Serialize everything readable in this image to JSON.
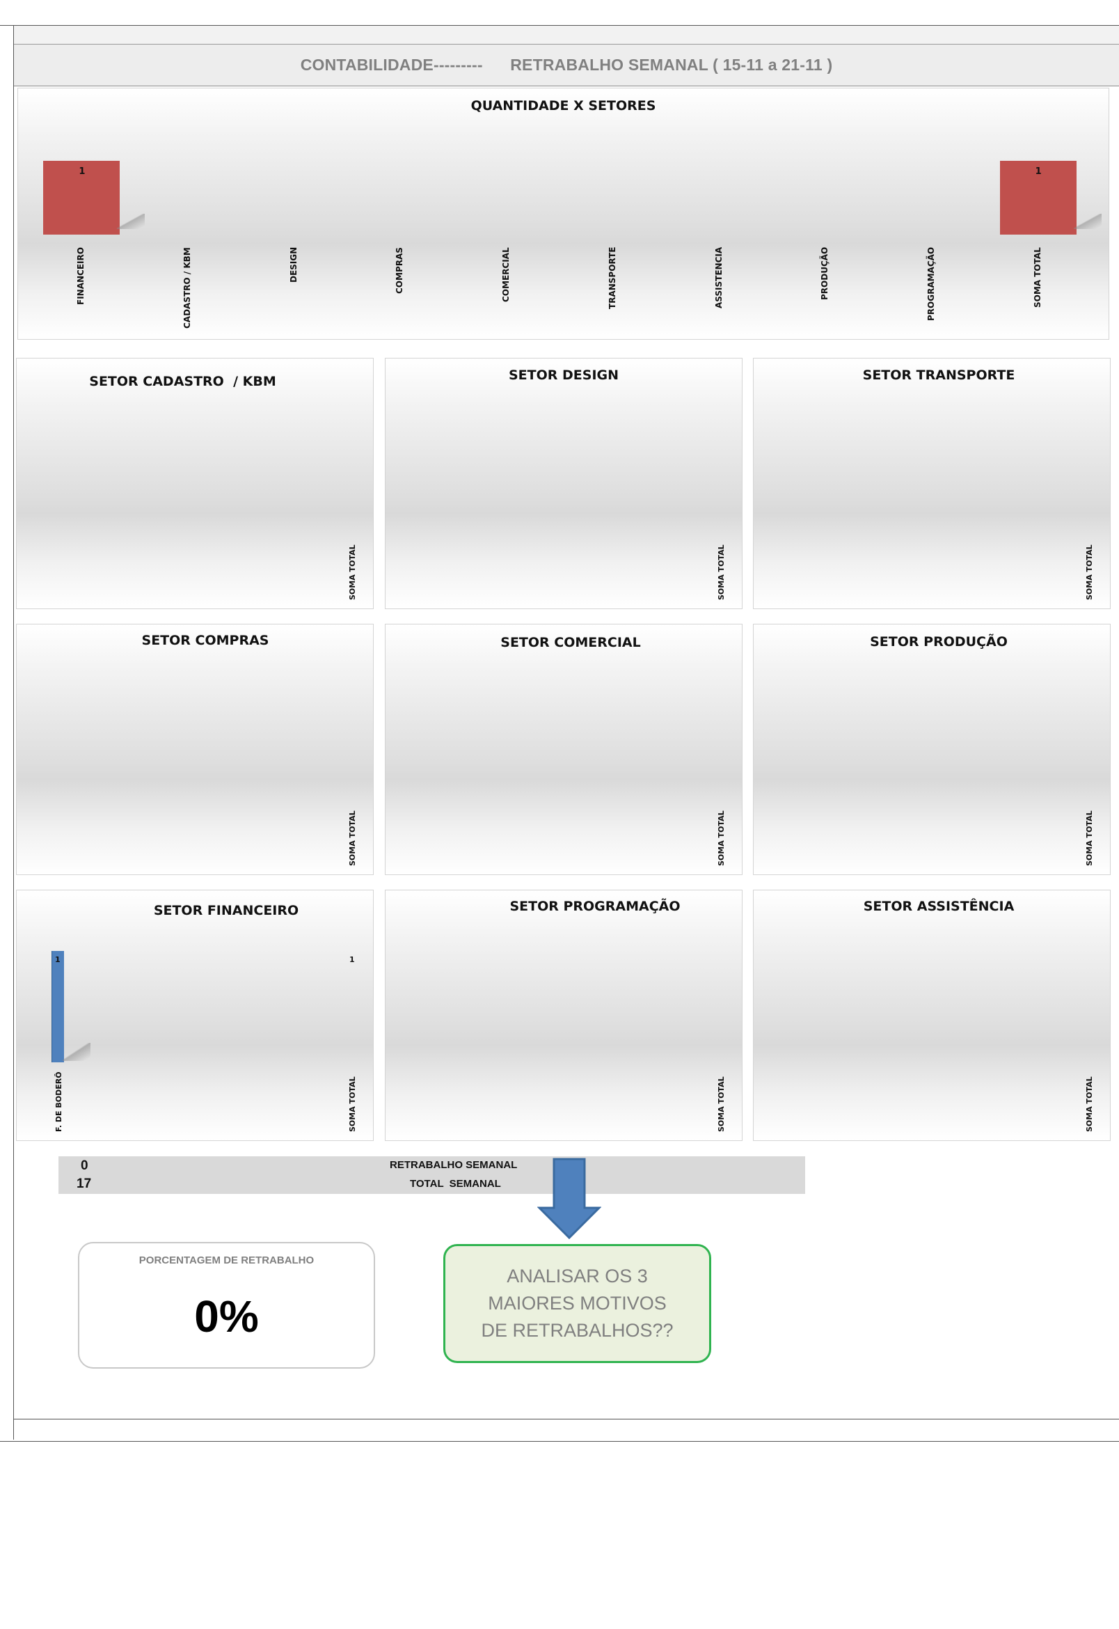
{
  "header": {
    "title_left": "CONTABILIDADE---------",
    "title_right": "RETRABALHO SEMANAL ( 15-11 a 21-11 )"
  },
  "colors": {
    "bar_red": "#c0504d",
    "bar_blue": "#4f81bd",
    "accent_green": "#2fb34f",
    "arrow_blue": "#4f81bd"
  },
  "chart_data": [
    {
      "type": "bar",
      "title": "QUANTIDADE X SETORES",
      "categories": [
        "FINANCEIRO",
        "CADASTRO / KBM",
        "DESIGN",
        "COMPRAS",
        "COMERCIAL",
        "TRANSPORTE",
        "ASSISTENCIA",
        "PRODUÇÃO",
        "PROGRAMAÇÃO",
        "SOMA TOTAL"
      ],
      "values": [
        1,
        null,
        null,
        null,
        null,
        null,
        null,
        null,
        null,
        1
      ],
      "data_labels": [
        "1",
        "",
        "",
        "",
        "",
        "",
        "",
        "",
        "",
        "1"
      ],
      "color": "#c0504d",
      "grid": false
    },
    {
      "type": "bar",
      "title": "SETOR CADASTRO  / KBM",
      "categories": [
        "SOMA TOTAL"
      ],
      "values": [
        null
      ]
    },
    {
      "type": "bar",
      "title": "SETOR DESIGN",
      "categories": [
        "SOMA TOTAL"
      ],
      "values": [
        null
      ]
    },
    {
      "type": "bar",
      "title": "SETOR TRANSPORTE",
      "categories": [
        "SOMA TOTAL"
      ],
      "values": [
        null
      ]
    },
    {
      "type": "bar",
      "title": "SETOR COMPRAS",
      "categories": [
        "SOMA TOTAL"
      ],
      "values": [
        null
      ]
    },
    {
      "type": "bar",
      "title": "SETOR COMERCIAL",
      "categories": [
        "SOMA TOTAL"
      ],
      "values": [
        null
      ]
    },
    {
      "type": "bar",
      "title": "SETOR PRODUÇÃO",
      "categories": [
        "SOMA TOTAL"
      ],
      "values": [
        null
      ]
    },
    {
      "type": "bar",
      "title": "SETOR FINANCEIRO",
      "categories": [
        "F. DE BODERÔ",
        "SOMA TOTAL"
      ],
      "values": [
        1,
        1
      ],
      "data_labels": [
        "1",
        "1"
      ],
      "color": "#4f81bd"
    },
    {
      "type": "bar",
      "title": "SETOR PROGRAMAÇÃO",
      "categories": [
        "SOMA TOTAL"
      ],
      "values": [
        null
      ]
    },
    {
      "type": "bar",
      "title": "SETOR ASSISTÊNCIA",
      "categories": [
        "SOMA TOTAL"
      ],
      "values": [
        null
      ]
    }
  ],
  "summary": {
    "retrabalho_value": "0",
    "retrabalho_label": "RETRABALHO SEMANAL",
    "total_value": "17",
    "total_label": "TOTAL  SEMANAL"
  },
  "percent_box": {
    "title": "PORCENTAGEM DE RETRABALHO",
    "value": "0%"
  },
  "callout": {
    "text": "ANALISAR OS 3 MAIORES MOTIVOS DE RETRABALHOS??"
  }
}
